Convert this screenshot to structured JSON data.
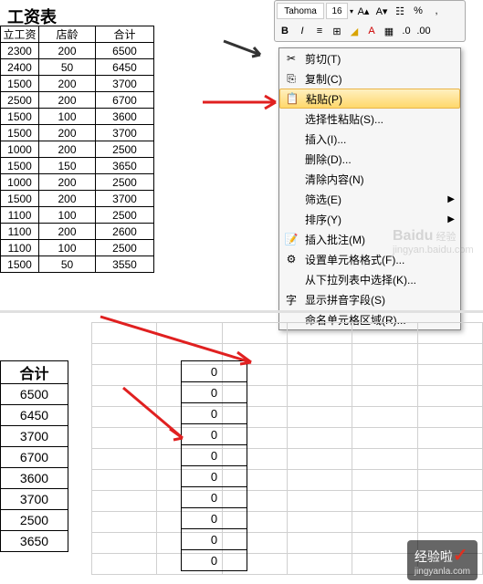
{
  "title": "工资表",
  "table1": {
    "headers": [
      "立工资",
      "店龄",
      "合计"
    ],
    "rows": [
      [
        "2300",
        "200",
        "6500"
      ],
      [
        "2400",
        "50",
        "6450"
      ],
      [
        "1500",
        "200",
        "3700"
      ],
      [
        "2500",
        "200",
        "6700"
      ],
      [
        "1500",
        "100",
        "3600"
      ],
      [
        "1500",
        "200",
        "3700"
      ],
      [
        "1000",
        "200",
        "2500"
      ],
      [
        "1500",
        "150",
        "3650"
      ],
      [
        "1000",
        "200",
        "2500"
      ],
      [
        "1500",
        "200",
        "3700"
      ],
      [
        "1100",
        "100",
        "2500"
      ],
      [
        "1100",
        "200",
        "2600"
      ],
      [
        "1100",
        "100",
        "2500"
      ],
      [
        "1500",
        "50",
        "3550"
      ]
    ]
  },
  "toolbar": {
    "font": "Tahoma",
    "size": "16",
    "bold": "B",
    "italic": "I",
    "percent": "%"
  },
  "menu": {
    "items": [
      {
        "icon": "✂",
        "label": "剪切(T)"
      },
      {
        "icon": "⎘",
        "label": "复制(C)"
      },
      {
        "icon": "📋",
        "label": "粘贴(P)",
        "hover": true
      },
      {
        "icon": "",
        "label": "选择性粘贴(S)..."
      },
      {
        "icon": "",
        "label": "插入(I)..."
      },
      {
        "icon": "",
        "label": "删除(D)..."
      },
      {
        "icon": "",
        "label": "清除内容(N)"
      },
      {
        "icon": "",
        "label": "筛选(E)",
        "submenu": true
      },
      {
        "icon": "",
        "label": "排序(Y)",
        "submenu": true
      },
      {
        "icon": "📝",
        "label": "插入批注(M)"
      },
      {
        "icon": "⚙",
        "label": "设置单元格格式(F)..."
      },
      {
        "icon": "",
        "label": "从下拉列表中选择(K)..."
      },
      {
        "icon": "字",
        "label": "显示拼音字段(S)"
      },
      {
        "icon": "",
        "label": "命名单元格区域(R)..."
      }
    ]
  },
  "table2": {
    "header": "合计",
    "rows": [
      "6500",
      "6450",
      "3700",
      "6700",
      "3600",
      "3700",
      "2500",
      "3650"
    ]
  },
  "table3": {
    "rows": [
      "0",
      "0",
      "0",
      "0",
      "0",
      "0",
      "0",
      "0",
      "0",
      "0"
    ]
  },
  "watermark1": {
    "brand": "Baidu",
    "sub": "jingyan.baidu.com"
  },
  "watermark2": {
    "brand": "经验啦",
    "sub": "jingyanla.com"
  }
}
